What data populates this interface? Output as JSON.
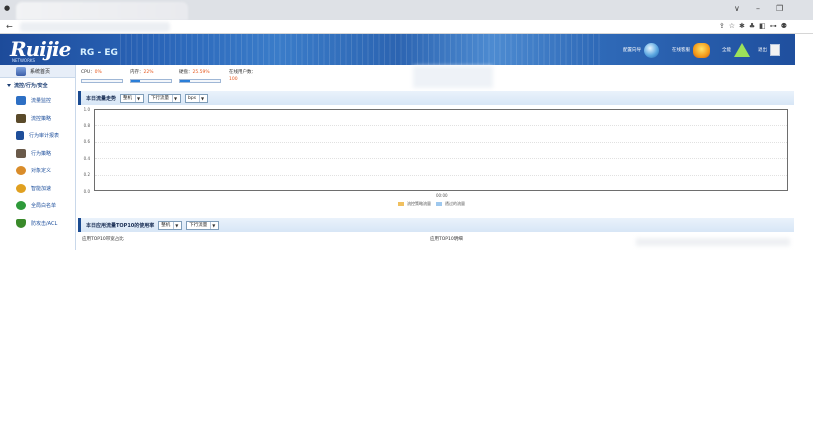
{
  "browser": {
    "back_symbol": "←",
    "window_controls": [
      "∨",
      "–",
      "❐"
    ],
    "ext_icons": "⇪☆✱♣◧⊶⚉"
  },
  "banner": {
    "logo": "Ruijie",
    "logo_sub": "NETWORKS",
    "model": "RG - EG",
    "buttons": [
      {
        "label": "配置向导",
        "icon": "globe-icon"
      },
      {
        "label": "在线客服",
        "icon": "people-icon"
      },
      {
        "label": "全能",
        "icon": "triangle-icon"
      },
      {
        "label": "退出",
        "icon": "exit-icon"
      }
    ]
  },
  "sidebar": {
    "home": "系统首页",
    "group": "流控/行为/安全",
    "items": [
      {
        "label": "流量监控",
        "color": "#2d6fc4"
      },
      {
        "label": "流控策略",
        "color": "#5a4a2a"
      },
      {
        "label": "行为审计报表",
        "color": "#1e4e9a"
      },
      {
        "label": "行为策略",
        "color": "#6a5a4a"
      },
      {
        "label": "对象定义",
        "color": "#d98c2a"
      },
      {
        "label": "智能加速",
        "color": "#e0a020"
      },
      {
        "label": "全局白名单",
        "color": "#2e9a3a"
      },
      {
        "label": "防攻击/ACL",
        "color": "#3a8a2a"
      }
    ]
  },
  "status": {
    "cpu_label": "CPU：",
    "cpu_value": "0%",
    "cpu_fraction": 0.0,
    "mem_label": "内存：",
    "mem_value": "22%",
    "mem_fraction": 0.22,
    "disk_label": "硬盘：",
    "disk_value": "25.59%",
    "disk_fraction": 0.2559,
    "online_label": "在线用户数：",
    "online_value": "100"
  },
  "traffic": {
    "title": "本日流量走势",
    "selects": [
      "整机",
      "下行流量",
      "bps"
    ],
    "legend": [
      {
        "label": "流控策略流量",
        "color": "#f0c060"
      },
      {
        "label": "透过的流量",
        "color": "#9ec8ee"
      }
    ]
  },
  "chart_data": {
    "type": "area",
    "y_ticks": [
      "1.0",
      "0.8",
      "0.6",
      "0.4",
      "0.2",
      "0.0"
    ],
    "ylim": [
      0,
      1.0
    ],
    "x_ticks": [
      "00:00"
    ],
    "series": [
      {
        "name": "流控策略流量",
        "values": []
      },
      {
        "name": "透过的流量",
        "values": []
      }
    ],
    "grid": true,
    "legend_position": "bottom"
  },
  "top10": {
    "title": "本日应用流量TOP10的使用率",
    "selects": [
      "整机",
      "下行流量"
    ],
    "left_label": "应用TOP10带宽占比",
    "right_label": "应用TOP10明细"
  }
}
